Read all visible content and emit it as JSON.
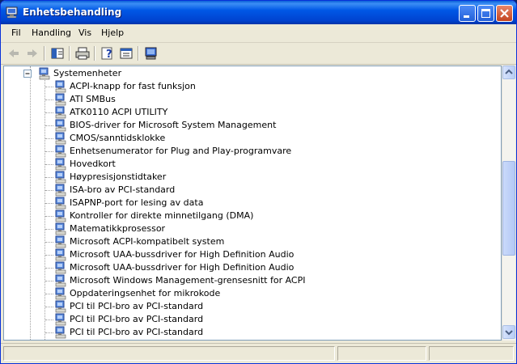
{
  "window": {
    "title": "Enhetsbehandling"
  },
  "menu": {
    "file": "Fil",
    "action": "Handling",
    "view": "Vis",
    "help": "Hjelp"
  },
  "tree": {
    "category": "Systemenheter",
    "items": [
      "ACPI-knapp for fast funksjon",
      "ATI SMBus",
      "ATK0110 ACPI UTILITY",
      "BIOS-driver for Microsoft System Management",
      "CMOS/sanntidsklokke",
      "Enhetsenumerator for Plug and Play-programvare",
      "Hovedkort",
      "Høypresisjonstidtaker",
      "ISA-bro av PCI-standard",
      "ISAPNP-port for lesing av data",
      "Kontroller for direkte minnetilgang (DMA)",
      "Matematikkprosessor",
      "Microsoft ACPI-kompatibelt system",
      "Microsoft UAA-bussdriver for High Definition Audio",
      "Microsoft UAA-bussdriver for High Definition Audio",
      "Microsoft Windows Management-grensesnitt for ACPI",
      "Oppdateringsenhet for mikrokode",
      "PCI til PCI-bro av PCI-standard",
      "PCI til PCI-bro av PCI-standard",
      "PCI til PCI-bro av PCI-standard"
    ]
  },
  "colors": {
    "titlebar": "#0058e6",
    "selection_none": "#ffffff",
    "chrome": "#ece9d8"
  }
}
